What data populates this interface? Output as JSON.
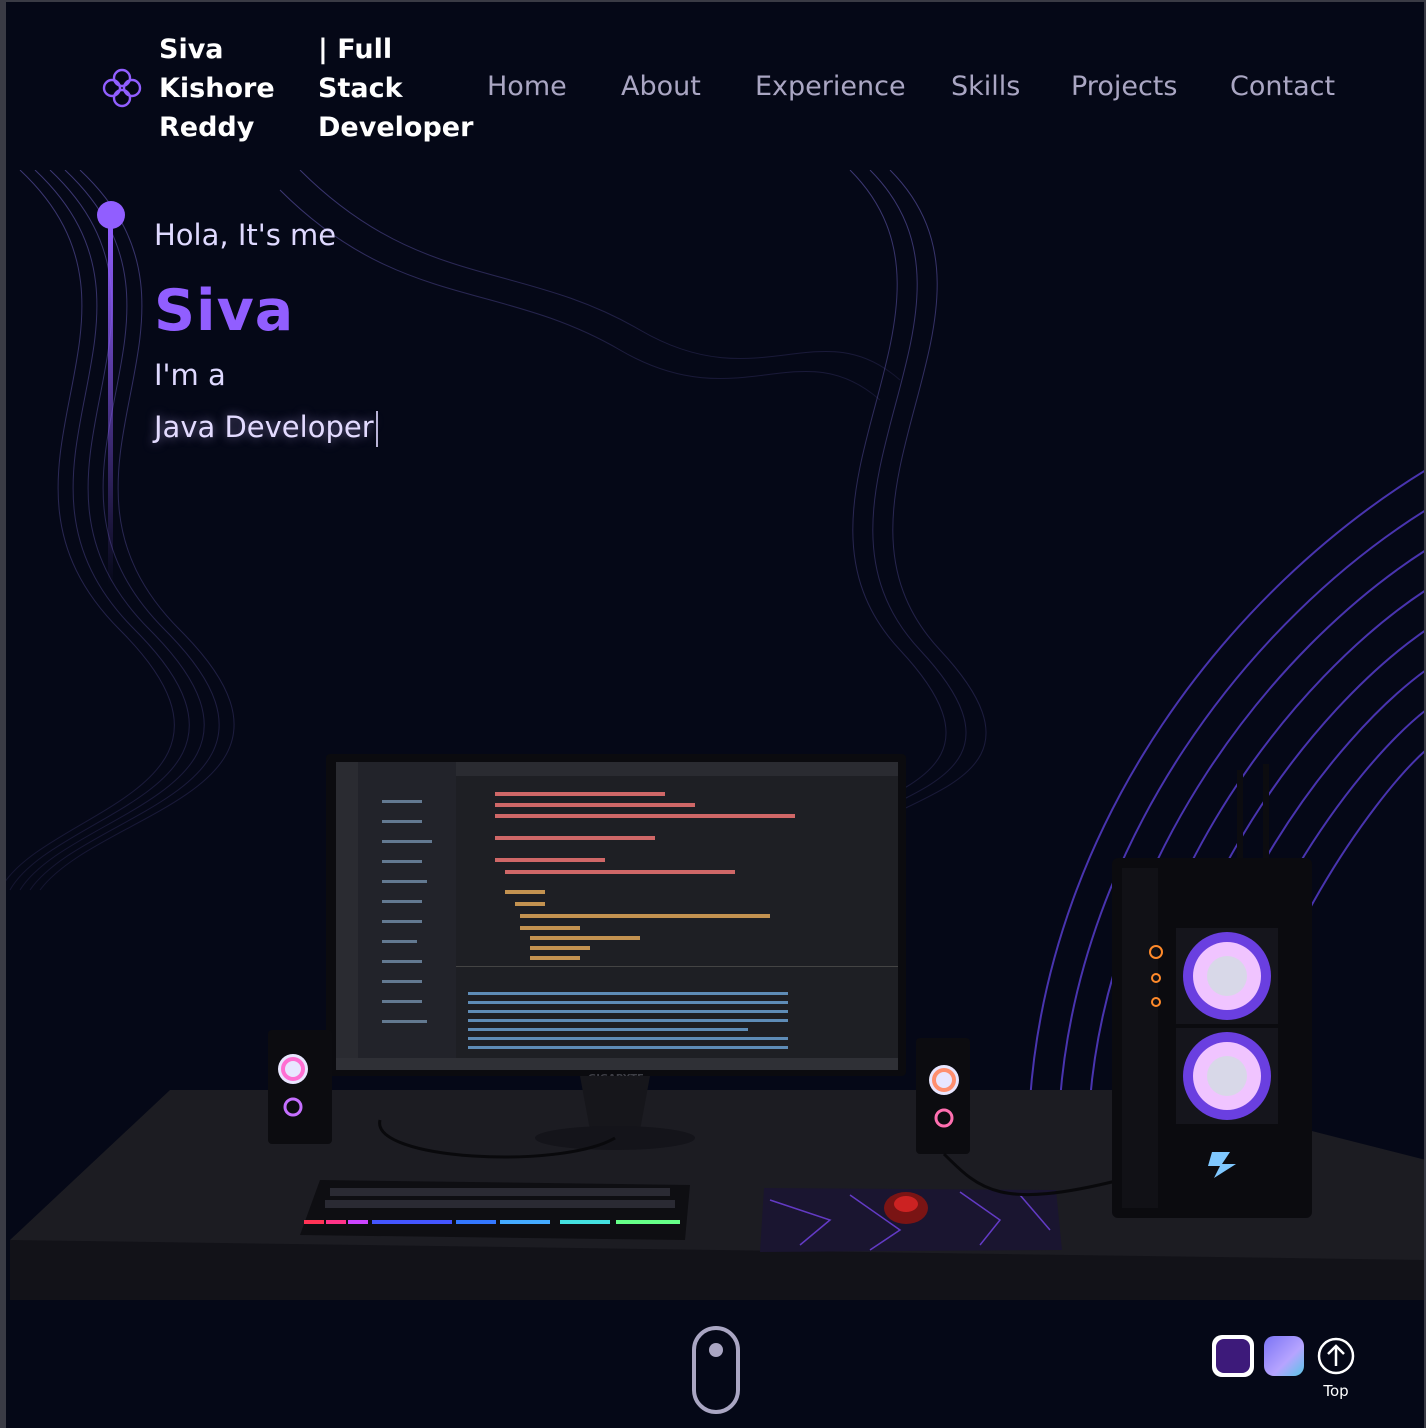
{
  "header": {
    "brand_name": "Siva Kishore Reddy",
    "brand_tagline": "| Full Stack Developer",
    "nav": [
      "Home",
      "About",
      "Experience",
      "Skills",
      "Projects",
      "Contact"
    ]
  },
  "hero": {
    "greeting": "Hola, It's me",
    "name": "Siva",
    "intro": "I'm a",
    "role": "Java Developer"
  },
  "scene": {
    "monitor_brand": "GIGABYTE"
  },
  "controls": {
    "top_label": "Top"
  },
  "colors": {
    "background": "#050817",
    "accent": "#915eff",
    "nav_text": "#aaa6c3"
  },
  "icons": [
    "logo-icon",
    "mouse-scroll-icon",
    "arrow-up-icon"
  ]
}
